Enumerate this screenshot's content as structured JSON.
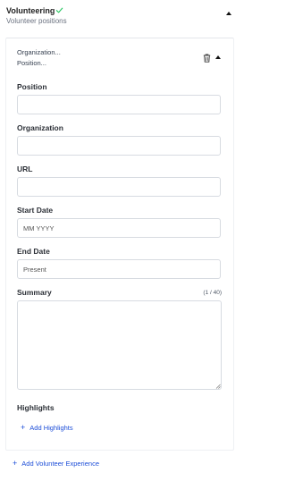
{
  "section": {
    "title": "Volunteering",
    "subtitle": "Volunteer positions"
  },
  "item": {
    "summary_org": "Organization...",
    "summary_position": "Position...",
    "fields": {
      "position": {
        "label": "Position",
        "value": "",
        "placeholder": ""
      },
      "organization": {
        "label": "Organization",
        "value": "",
        "placeholder": ""
      },
      "url": {
        "label": "URL",
        "value": "",
        "placeholder": ""
      },
      "start_date": {
        "label": "Start Date",
        "value": "",
        "placeholder": "MM YYYY"
      },
      "end_date": {
        "label": "End Date",
        "value": "",
        "placeholder": "Present"
      },
      "summary": {
        "label": "Summary",
        "counter": "(1 / 40)",
        "value": ""
      }
    },
    "highlights": {
      "label": "Highlights",
      "add_label": "Add Highlights"
    }
  },
  "add_section_label": "Add Volunteer Experience",
  "colors": {
    "accent": "#1d4ed8",
    "check": "#22c55e",
    "border": "#d7dbe1"
  },
  "icons": {
    "check": "check-icon",
    "collapse": "chevron-up-icon",
    "delete": "trash-icon",
    "add": "plus-icon"
  }
}
